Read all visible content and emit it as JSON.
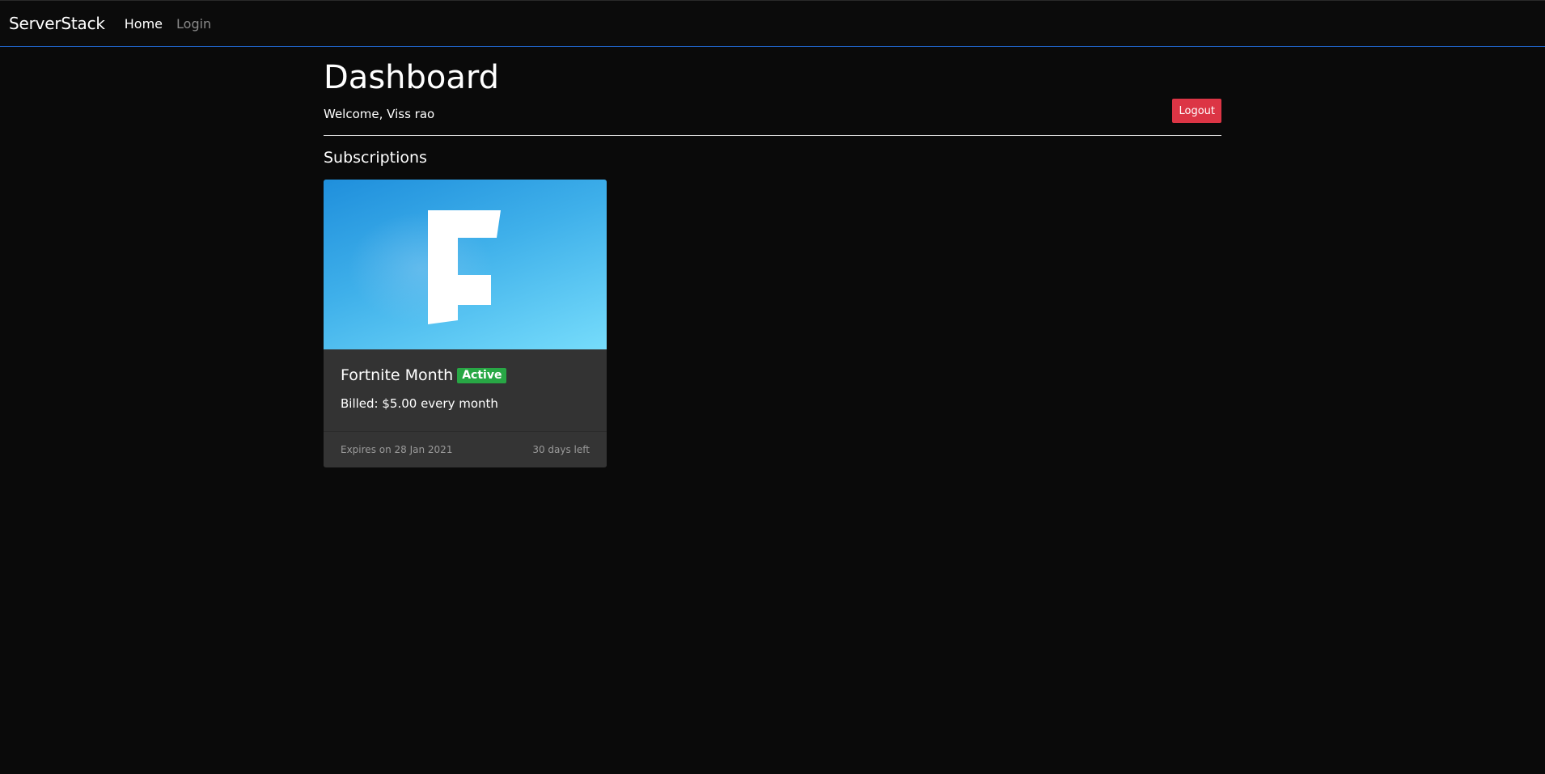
{
  "nav": {
    "brand": "ServerStack",
    "links": [
      {
        "label": "Home",
        "active": true
      },
      {
        "label": "Login",
        "active": false
      }
    ]
  },
  "header": {
    "title": "Dashboard",
    "welcome": "Welcome, Viss rao",
    "logout_label": "Logout"
  },
  "subscriptions": {
    "section_title": "Subscriptions",
    "items": [
      {
        "image_icon": "fortnite-logo",
        "image_letter": "F",
        "name": "Fortnite Month",
        "status": "Active",
        "billed": "Billed: $5.00 every month",
        "expires": "Expires on 28 Jan 2021",
        "days_left": "30 days left"
      }
    ]
  },
  "colors": {
    "background": "#0a0a0a",
    "nav_border": "#1f5fbf",
    "logout": "#dc3545",
    "badge_active": "#28a745",
    "card_bg": "#333333"
  }
}
